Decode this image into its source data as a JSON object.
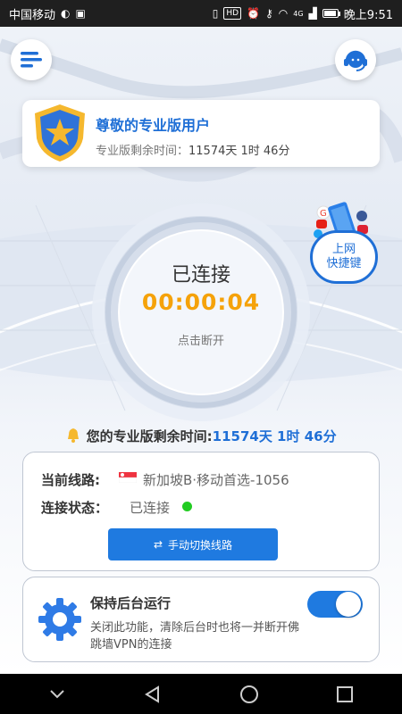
{
  "status_bar": {
    "carrier": "中国移动",
    "signal_tag": "4G",
    "hd_tag": "HD",
    "time": "晚上9:51",
    "battery_level": 0.9
  },
  "header": {
    "menu_icon": "menu-icon",
    "support_icon": "headset-icon"
  },
  "pro_card": {
    "title": "尊敬的专业版用户",
    "remaining_label": "专业版剩余时间：",
    "remaining_value": "11574天 1时 46分"
  },
  "connection": {
    "status": "已连接",
    "timer": "00:00:04",
    "disconnect_hint": "点击断开"
  },
  "shortcut": {
    "line1": "上网",
    "line2": "快捷键"
  },
  "remaining_banner": {
    "label": "您的专业版剩余时间:",
    "value": "11574天 1时 46分"
  },
  "route_card": {
    "line_label": "当前线路:",
    "line_value": "新加坡B·移动首选-1056",
    "status_label": "连接状态：",
    "status_value": "已连接",
    "switch_button": "手动切换线路",
    "switch_icon": "swap-icon"
  },
  "background_card": {
    "title": "保持后台运行",
    "description": "关闭此功能，清除后台时也将一并断开佛跳墙VPN的连接",
    "toggle_on": true
  },
  "colors": {
    "brand_blue": "#1f6fd6",
    "timer_orange": "#f5a20a",
    "connected_green": "#22cc22"
  }
}
